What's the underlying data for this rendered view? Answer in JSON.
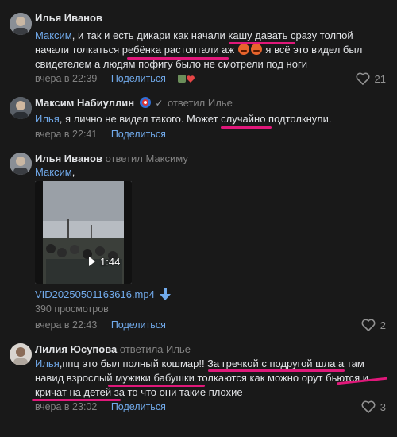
{
  "comments": [
    {
      "author": "Илья Иванов",
      "replied": "",
      "mention": "Максим",
      "text_line1": ", и так и есть дикари как начали кашу давать сразу толпой",
      "text_line2a": "начали толкаться ребёнка растоптали аж",
      "text_line2b": "я всё это видел был",
      "text_line3": "свидетелем а людям пофигу было не смотрели под ноги",
      "time": "вчера в 22:39",
      "share": "Поделиться",
      "likes": "21"
    },
    {
      "author": "Максим Набиуллин",
      "replied": "ответил Илье",
      "mention": "Илья",
      "text_line1": ", я лично не видел такого. Может случайно подтолкнули.",
      "time": "вчера в 22:41",
      "share": "Поделиться",
      "likes": ""
    },
    {
      "author": "Илья Иванов",
      "replied": "ответил Максиму",
      "mention": "Максим",
      "text_line1": ",",
      "video_duration": "1:44",
      "file_name": "VID20250501163616.mp4",
      "views": "390 просмотров",
      "time": "вчера в 22:43",
      "share": "Поделиться",
      "likes": "2"
    },
    {
      "author": "Лилия Юсупова",
      "replied": "ответила Илье",
      "mention": "Илья",
      "text_line1": ",ппц это был полный кошмар!! За гречкой с подругой шла а там",
      "text_line2": "навид взрослый мужики бабушки толкаются как можно орут бьются и",
      "text_line3": "кричат на детей за то что они такие плохие",
      "time": "вчера в 23:02",
      "share": "Поделиться",
      "likes": "3"
    }
  ],
  "colors": {
    "background": "#191919",
    "link": "#71aaeb",
    "highlight": "#e0187a"
  },
  "icons": [
    "heart-icon",
    "download-arrow-icon",
    "play-icon",
    "verified-icon"
  ]
}
